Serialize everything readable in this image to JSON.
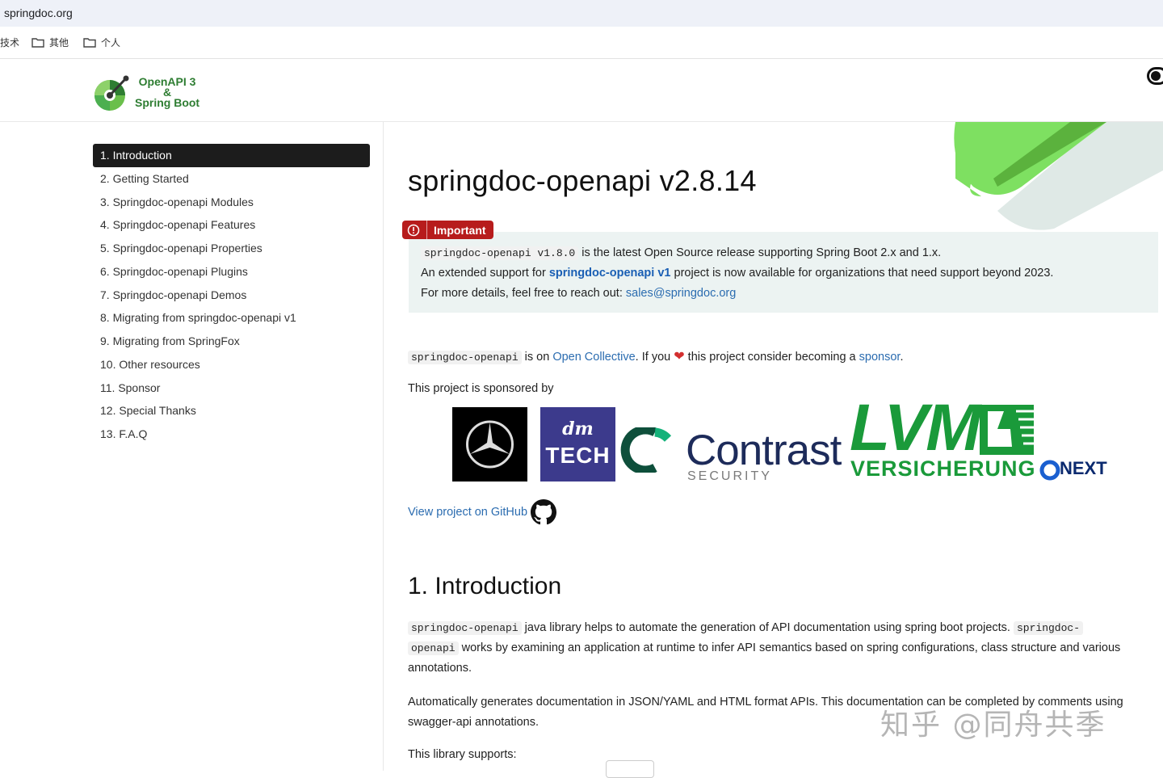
{
  "browser": {
    "url": "springdoc.org",
    "bookmarks": [
      {
        "label": "技术",
        "icon": "none"
      },
      {
        "label": "其他",
        "icon": "folder-icon"
      },
      {
        "label": "个人",
        "icon": "folder-icon"
      }
    ]
  },
  "header": {
    "logo_line1": "OpenAPI 3",
    "logo_line2": "&",
    "logo_line3": "Spring Boot"
  },
  "sidebar": {
    "items": [
      {
        "label": "1. Introduction",
        "active": true
      },
      {
        "label": "2. Getting Started"
      },
      {
        "label": "3. Springdoc-openapi Modules"
      },
      {
        "label": "4. Springdoc-openapi Features"
      },
      {
        "label": "5. Springdoc-openapi Properties"
      },
      {
        "label": "6. Springdoc-openapi Plugins"
      },
      {
        "label": "7. Springdoc-openapi Demos"
      },
      {
        "label": "8. Migrating from springdoc-openapi v1"
      },
      {
        "label": "9. Migrating from SpringFox"
      },
      {
        "label": "10. Other resources"
      },
      {
        "label": "11. Sponsor"
      },
      {
        "label": "12. Special Thanks"
      },
      {
        "label": "13. F.A.Q"
      }
    ]
  },
  "main": {
    "title": "springdoc-openapi v2.8.14",
    "important": {
      "badge": "Important",
      "line1_code": "springdoc-openapi v1.8.0",
      "line1_text": " is the latest Open Source release supporting Spring Boot 2.x and 1.x.",
      "line2_pre": "An extended support for ",
      "line2_link": "springdoc-openapi v1",
      "line2_post": " project is now available for organizations that need support beyond 2023.",
      "line3_pre": "For more details, feel free to reach out: ",
      "line3_link": "sales@springdoc.org"
    },
    "collective": {
      "code": "springdoc-openapi",
      "t1": " is on ",
      "link1": "Open Collective",
      "t2": ". If you ",
      "heart": "❤",
      "t3": " this project consider becoming a ",
      "link2": "sponsor",
      "t4": "."
    },
    "sponsored_by": "This project is sponsored by",
    "sponsors": {
      "dm_top": "dm",
      "dm_bottom": "TECH",
      "contrast": "Contrast",
      "contrast_sub": "SECURITY",
      "lvm": "LVM",
      "lvm_sub": "VERSICHERUNG",
      "next": "NEXT"
    },
    "github_link": "View project on GitHub",
    "intro_heading": "1. Introduction",
    "intro_p1_code1": "springdoc-openapi",
    "intro_p1_text1": " java library helps to automate the generation of API documentation using spring boot projects. ",
    "intro_p1_code2a": "springdoc-",
    "intro_p1_code2b": "openapi",
    "intro_p1_text2": " works by examining an application at runtime to infer API semantics based on spring configurations, class structure and various annotations.",
    "intro_p2": "Automatically generates documentation in JSON/YAML and HTML format APIs. This documentation can be completed by comments using swagger-api annotations.",
    "intro_p3": "This library supports:"
  },
  "watermark": "知乎 @同舟共季",
  "colors": {
    "active_nav_bg": "#1c1c1c",
    "important_badge": "#b71c1c",
    "note_bg": "#ecf3f2",
    "link": "#2b6cb0",
    "brand_green": "#2e7d32"
  }
}
